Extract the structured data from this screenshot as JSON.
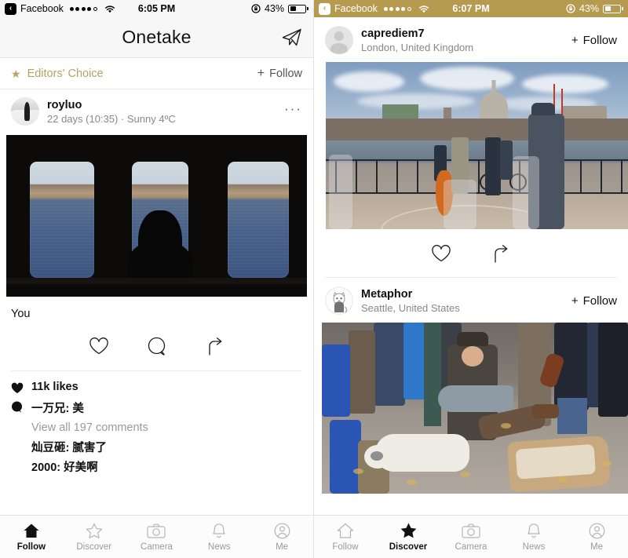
{
  "left_phone": {
    "statusbar": {
      "back_glyph": "‹",
      "carrier": "Facebook",
      "signal_dots": [
        true,
        true,
        true,
        true,
        false
      ],
      "wifi_icon": "wifi-icon",
      "time": "6:05 PM",
      "lock_icon": "rotation-lock-icon",
      "battery_percent": "43%",
      "battery_level": 43,
      "background": "#f7f7f7"
    },
    "navbar": {
      "title": "Onetake",
      "send_icon": "paper-plane-icon"
    },
    "editors_choice": {
      "star_icon": "star-filled-icon",
      "label": "Editors' Choice",
      "plus": "+",
      "follow_label": "Follow",
      "accent_color": "#b9a15e"
    },
    "post": {
      "avatar_icon": "user-avatar",
      "username": "royluo",
      "meta": "22 days (10:35) · Sunny 4ºC",
      "more_icon": "more-options-icon",
      "photo_alt": "silhouette-at-ferry-window",
      "caption": "You",
      "actions": [
        {
          "icon": "heart-outline-icon",
          "name": "like-button"
        },
        {
          "icon": "comment-bubble-icon",
          "name": "comment-button"
        },
        {
          "icon": "share-arrow-icon",
          "name": "share-button"
        }
      ],
      "likes_icon": "heart-filled-icon",
      "likes_text": "11k likes",
      "comment_icon": "comment-filled-icon",
      "top_comment": "一万兄: 美",
      "view_all": "View all 197 comments",
      "comments": [
        "灿豆砸: 腻害了",
        "2000: 好美啊"
      ]
    },
    "tabbar": {
      "items": [
        {
          "label": "Follow",
          "icon": "home-icon",
          "active": true
        },
        {
          "label": "Discover",
          "icon": "star-icon",
          "active": false
        },
        {
          "label": "Camera",
          "icon": "camera-icon",
          "active": false
        },
        {
          "label": "News",
          "icon": "bell-icon",
          "active": false
        },
        {
          "label": "Me",
          "icon": "person-icon",
          "active": false
        }
      ]
    }
  },
  "right_phone": {
    "statusbar": {
      "back_glyph": "‹",
      "carrier": "Facebook",
      "signal_dots": [
        true,
        true,
        true,
        true,
        false
      ],
      "wifi_icon": "wifi-icon",
      "time": "6:07 PM",
      "lock_icon": "rotation-lock-icon",
      "battery_percent": "43%",
      "battery_level": 43,
      "background": "#b59a50"
    },
    "posts": [
      {
        "avatar_icon": "default-user-avatar",
        "username": "caprediem7",
        "location": "London, United Kingdom",
        "plus": "+",
        "follow_label": "Follow",
        "photo_alt": "london-millennium-bridge-musicians",
        "actions": [
          {
            "icon": "heart-outline-icon",
            "name": "like-button"
          },
          {
            "icon": "share-arrow-icon",
            "name": "share-button"
          }
        ]
      },
      {
        "avatar_icon": "cat-avatar",
        "username": "Metaphor",
        "location": "Seattle, United States",
        "plus": "+",
        "follow_label": "Follow",
        "photo_alt": "street-guitarist-with-dog"
      }
    ],
    "tabbar": {
      "items": [
        {
          "label": "Follow",
          "icon": "home-icon",
          "active": false
        },
        {
          "label": "Discover",
          "icon": "star-icon",
          "active": true
        },
        {
          "label": "Camera",
          "icon": "camera-icon",
          "active": false
        },
        {
          "label": "News",
          "icon": "bell-icon",
          "active": false
        },
        {
          "label": "Me",
          "icon": "person-icon",
          "active": false
        }
      ]
    }
  }
}
